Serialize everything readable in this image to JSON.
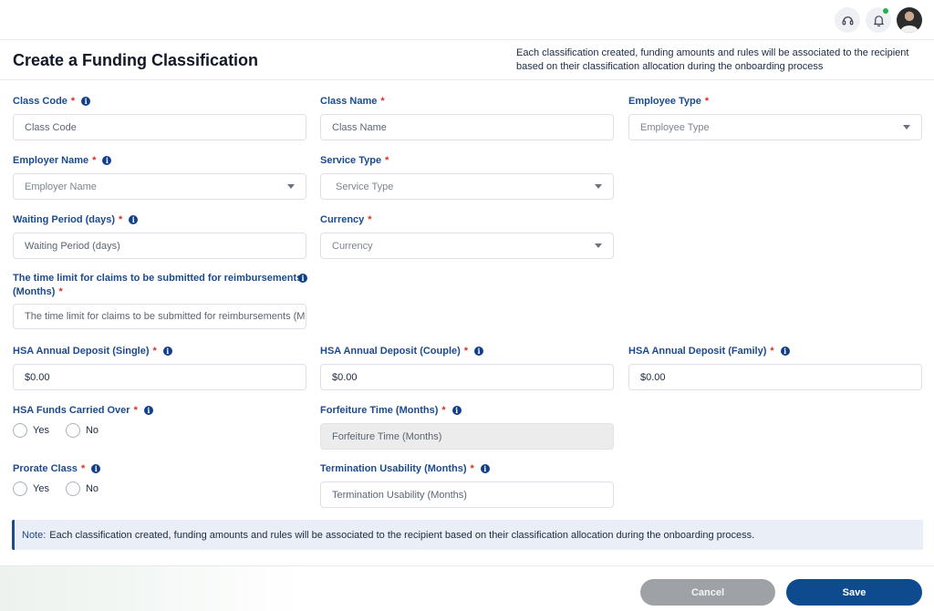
{
  "topbar": {
    "icons": [
      "headset-icon",
      "bell-icon",
      "user-avatar"
    ]
  },
  "header": {
    "title": "Create a Funding Classification",
    "description": "Each classification created, funding amounts and rules will be associated to the recipient based on their classification allocation during the onboarding process"
  },
  "form": {
    "class_code": {
      "label": "Class Code",
      "required": "*",
      "placeholder": "Class Code"
    },
    "class_name": {
      "label": "Class Name",
      "required": "*",
      "placeholder": "Class Name"
    },
    "employee_type": {
      "label": "Employee Type",
      "required": "*",
      "placeholder": "Employee Type"
    },
    "employer_name": {
      "label": "Employer Name",
      "required": "*",
      "placeholder": "Employer Name"
    },
    "service_type": {
      "label": "Service Type",
      "required": "*",
      "placeholder": "Service Type"
    },
    "waiting_period": {
      "label": "Waiting Period (days)",
      "required": "*",
      "placeholder": "Waiting Period (days)"
    },
    "currency": {
      "label": "Currency",
      "required": "*",
      "placeholder": "Currency"
    },
    "time_limit": {
      "label_line1": "The time limit for claims to be submitted for reimbursements",
      "label_line2": "(Months)",
      "required": "*",
      "placeholder": "The time limit for claims to be submitted for reimbursements (Months)"
    },
    "hsa_single": {
      "label": "HSA Annual Deposit (Single)",
      "required": "*",
      "value": "$0.00"
    },
    "hsa_couple": {
      "label": "HSA Annual Deposit (Couple)",
      "required": "*",
      "value": "$0.00"
    },
    "hsa_family": {
      "label": "HSA Annual Deposit (Family)",
      "required": "*",
      "value": "$0.00"
    },
    "hsa_carried": {
      "label": "HSA Funds Carried Over",
      "required": "*",
      "options": [
        "Yes",
        "No"
      ]
    },
    "forfeiture": {
      "label": "Forfeiture Time (Months)",
      "required": "*",
      "placeholder": "Forfeiture Time (Months)"
    },
    "prorate": {
      "label": "Prorate Class",
      "required": "*",
      "options": [
        "Yes",
        "No"
      ]
    },
    "termination": {
      "label": "Termination Usability (Months)",
      "required": "*",
      "placeholder": "Termination Usability (Months)"
    }
  },
  "note": {
    "label": "Note:",
    "text": "Each classification created, funding amounts and rules will be associated to the recipient based on their classification allocation during the onboarding process."
  },
  "footer": {
    "cancel_label": "Cancel",
    "save_label": "Save"
  },
  "colors": {
    "label": "#1c4a8c",
    "required": "#d93025",
    "primary_button": "#0e4a8e",
    "cancel_button": "#9ea1a6",
    "note_background": "#e9eef7"
  }
}
